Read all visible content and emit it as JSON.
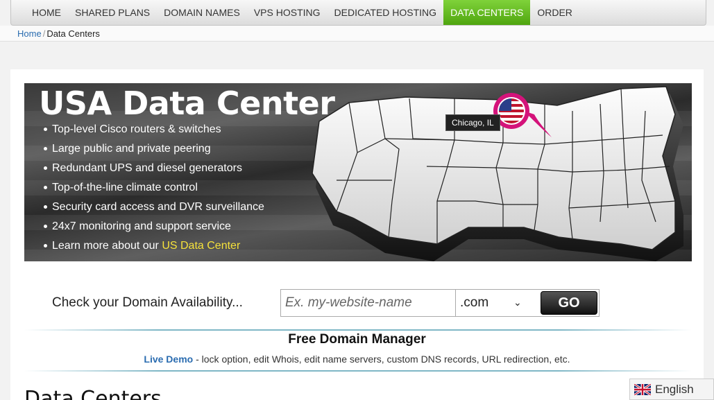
{
  "nav": {
    "items": [
      "HOME",
      "SHARED PLANS",
      "DOMAIN NAMES",
      "VPS HOSTING",
      "DEDICATED HOSTING",
      "DATA CENTERS",
      "ORDER"
    ],
    "active": "DATA CENTERS"
  },
  "breadcrumb": {
    "home": "Home",
    "current": "Data Centers"
  },
  "banner": {
    "title": "USA Data Center",
    "bullets": [
      "Top-level Cisco routers & switches",
      "Large public and private peering",
      "Redundant UPS and diesel generators",
      "Top-of-the-line climate control",
      "Security card access and DVR surveillance",
      "24x7 monitoring and support service"
    ],
    "learn_more_prefix": "Learn more about our ",
    "learn_more_link": "US Data Center",
    "pin_label": "Chicago, IL"
  },
  "domain_search": {
    "label": "Check your Domain Availability...",
    "placeholder": "Ex. my-website-name",
    "tld": ".com",
    "go": "GO"
  },
  "domain_manager": {
    "title": "Free Domain Manager",
    "demo_link": "Live Demo",
    "description": " - lock option, edit Whois, edit name servers, custom DNS records, URL redirection, etc."
  },
  "section_heading": "Data Centers",
  "language": {
    "label": "English"
  },
  "colors": {
    "nav_active": "#5bb31a",
    "link": "#2a6cb0",
    "highlight": "#f6e23b",
    "pin": "#d4137a"
  }
}
